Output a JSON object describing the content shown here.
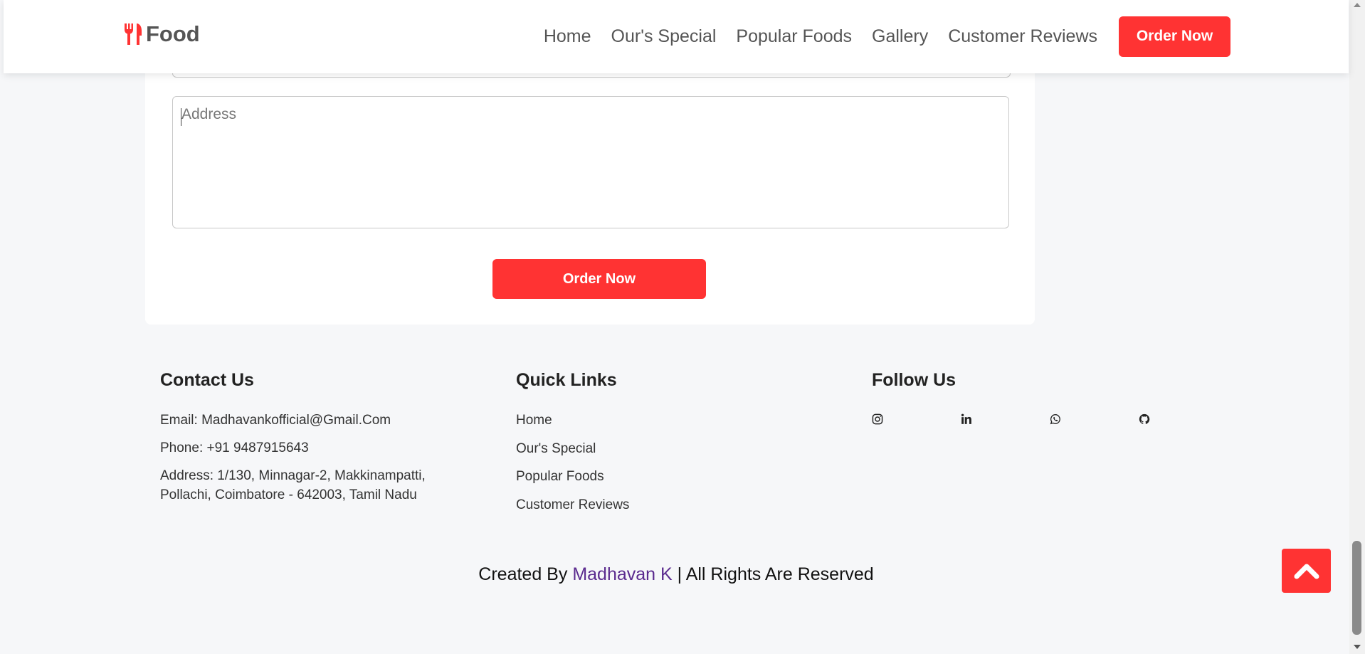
{
  "header": {
    "logo_text": "Food",
    "logo_icon": "utensils-icon",
    "nav": [
      "Home",
      "Our's Special",
      "Popular Foods",
      "Gallery",
      "Customer Reviews"
    ],
    "order_button": "Order Now"
  },
  "form": {
    "address_placeholder": "Address",
    "address_value": "",
    "submit_label": "Order Now"
  },
  "footer": {
    "contact": {
      "heading": "Contact Us",
      "email": "Email: Madhavankofficial@Gmail.Com",
      "phone": "Phone: +91 9487915643",
      "address": "Address: 1/130, Minnagar-2, Makkinampatti, Pollachi, Coimbatore - 642003, Tamil Nadu"
    },
    "quick_links": {
      "heading": "Quick Links",
      "items": [
        "Home",
        "Our's Special",
        "Popular Foods",
        "Customer Reviews"
      ]
    },
    "follow": {
      "heading": "Follow Us",
      "icons": [
        "instagram-icon",
        "linkedin-icon",
        "whatsapp-icon",
        "github-icon"
      ]
    },
    "credit_prefix": "Created By",
    "credit_author": "Madhavan K",
    "credit_suffix": "| All Rights Are Reserved"
  },
  "colors": {
    "accent": "#ff3333",
    "author_link": "#5b2b8f",
    "background": "#f6f7f9"
  }
}
